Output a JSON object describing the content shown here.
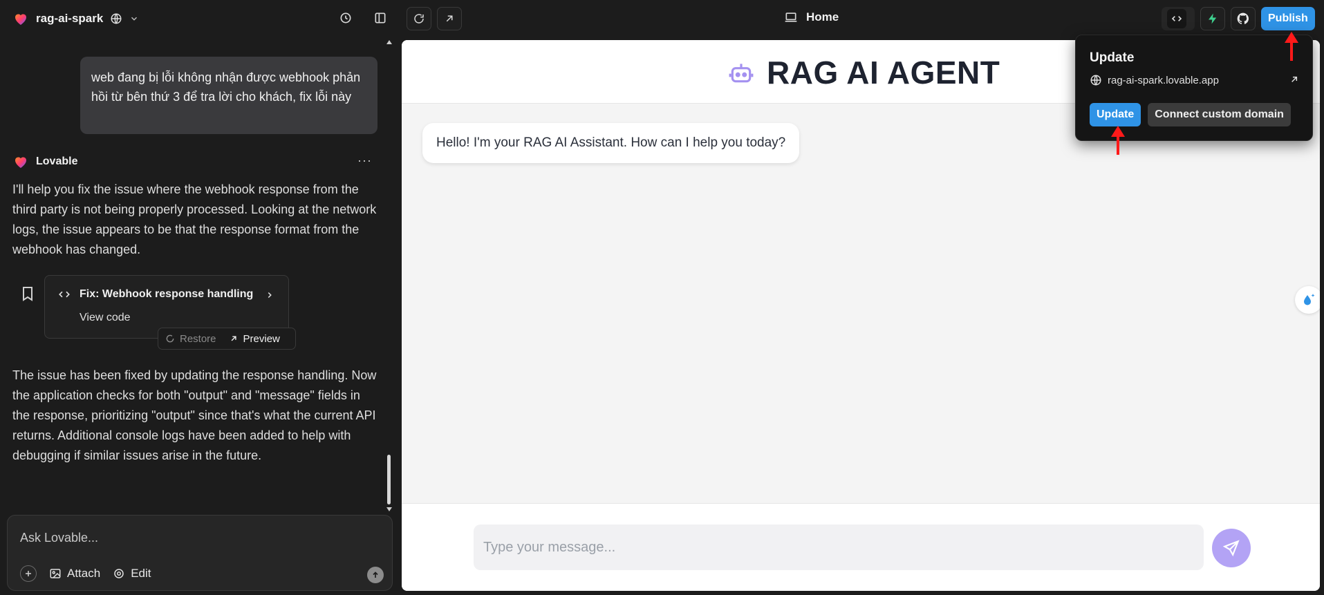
{
  "topbar": {
    "project_name": "rag-ai-spark",
    "page_label": "Home",
    "publish_label": "Publish"
  },
  "chat": {
    "user_message": "web đang bị lỗi không nhận được webhook phản hồi từ bên thứ 3 để tra lời cho khách, fix lỗi này",
    "assistant_name": "Lovable",
    "assistant_message_1": "I'll help you fix the issue where the webhook response from the third party is not being properly processed. Looking at the network logs, the issue appears to be that the response format from the webhook has changed.",
    "card_title": "Fix: Webhook response handling",
    "card_sub": "View code",
    "restore_label": "Restore",
    "preview_label": "Preview",
    "assistant_message_2": "The issue has been fixed by updating the response handling. Now the application checks for both \"output\" and \"message\" fields in the response, prioritizing \"output\" since that's what the current API returns. Additional console logs have been added to help with debugging if similar issues arise in the future.",
    "composer": {
      "placeholder": "Ask Lovable...",
      "attach_label": "Attach",
      "edit_label": "Edit"
    }
  },
  "preview": {
    "title": "RAG AI AGENT",
    "bot_greeting": "Hello! I'm your RAG AI Assistant. How can I help you today?",
    "input_placeholder": "Type your message..."
  },
  "popover": {
    "title": "Update",
    "url": "rag-ai-spark.lovable.app",
    "update_label": "Update",
    "domain_label": "Connect custom domain"
  },
  "colors": {
    "accent": "#2f93e6",
    "send_purple": "#b3a3f5",
    "annotation_red": "#ff1a1a"
  }
}
